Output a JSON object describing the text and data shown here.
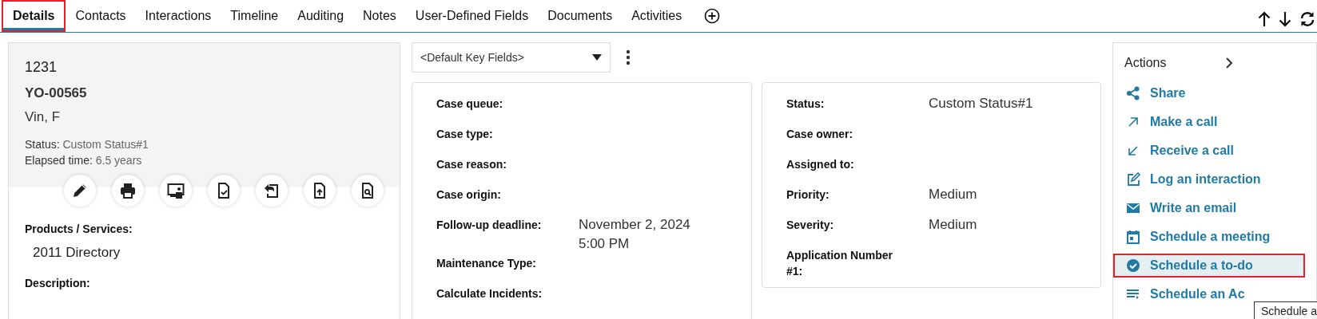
{
  "tabs": [
    {
      "label": "Details",
      "selected": true,
      "highlighted": true
    },
    {
      "label": "Contacts",
      "selected": false,
      "highlighted": false
    },
    {
      "label": "Interactions",
      "selected": false,
      "highlighted": false
    },
    {
      "label": "Timeline",
      "selected": false,
      "highlighted": false
    },
    {
      "label": "Auditing",
      "selected": false,
      "highlighted": false
    },
    {
      "label": "Notes",
      "selected": false,
      "highlighted": false
    },
    {
      "label": "User-Defined Fields",
      "selected": false,
      "highlighted": false
    },
    {
      "label": "Documents",
      "selected": false,
      "highlighted": false
    },
    {
      "label": "Activities",
      "selected": false,
      "highlighted": false
    }
  ],
  "record": {
    "number": "1231",
    "code": "YO-00565",
    "name": "Vin, F",
    "status_label": "Status:",
    "status_value": "Custom Status#1",
    "elapsed_label": "Elapsed time:",
    "elapsed_value": "6.5 years"
  },
  "record_fields": [
    {
      "label": "Products / Services:",
      "value": "2011 Directory"
    },
    {
      "label": "Description:"
    }
  ],
  "key_fields_select": {
    "value": "<Default Key Fields>"
  },
  "key_fields_left": [
    {
      "label": "Case queue:"
    },
    {
      "label": "Case type:"
    },
    {
      "label": "Case reason:"
    },
    {
      "label": "Case origin:"
    },
    {
      "label": "Follow-up deadline:",
      "value": "November 2, 2024 5:00 PM"
    },
    {
      "label": "Maintenance Type:"
    },
    {
      "label": "Calculate Incidents:"
    }
  ],
  "key_fields_right": [
    {
      "label": "Status:",
      "value": "Custom Status#1"
    },
    {
      "label": "Case owner:"
    },
    {
      "label": "Assigned to:"
    },
    {
      "label": "Priority:",
      "value": "Medium"
    },
    {
      "label": "Severity:",
      "value": "Medium"
    },
    {
      "label": "Application Number #1:"
    }
  ],
  "actions": {
    "title": "Actions",
    "items": [
      {
        "label": "Share",
        "kind": "share",
        "hovered": false,
        "highlighted": false
      },
      {
        "label": "Make a call",
        "kind": "outgoing",
        "hovered": false,
        "highlighted": false
      },
      {
        "label": "Receive a call",
        "kind": "incoming",
        "hovered": false,
        "highlighted": false
      },
      {
        "label": "Log an interaction",
        "kind": "edit",
        "hovered": false,
        "highlighted": false
      },
      {
        "label": "Write an email",
        "kind": "email",
        "hovered": false,
        "highlighted": false
      },
      {
        "label": "Schedule a meeting",
        "kind": "calendar",
        "hovered": false,
        "highlighted": false
      },
      {
        "label": "Schedule a to-do",
        "kind": "todo",
        "hovered": true,
        "highlighted": true
      },
      {
        "label": "Schedule an Ac",
        "kind": "list",
        "hovered": false,
        "highlighted": false
      }
    ]
  },
  "tooltip": "Schedule a"
}
